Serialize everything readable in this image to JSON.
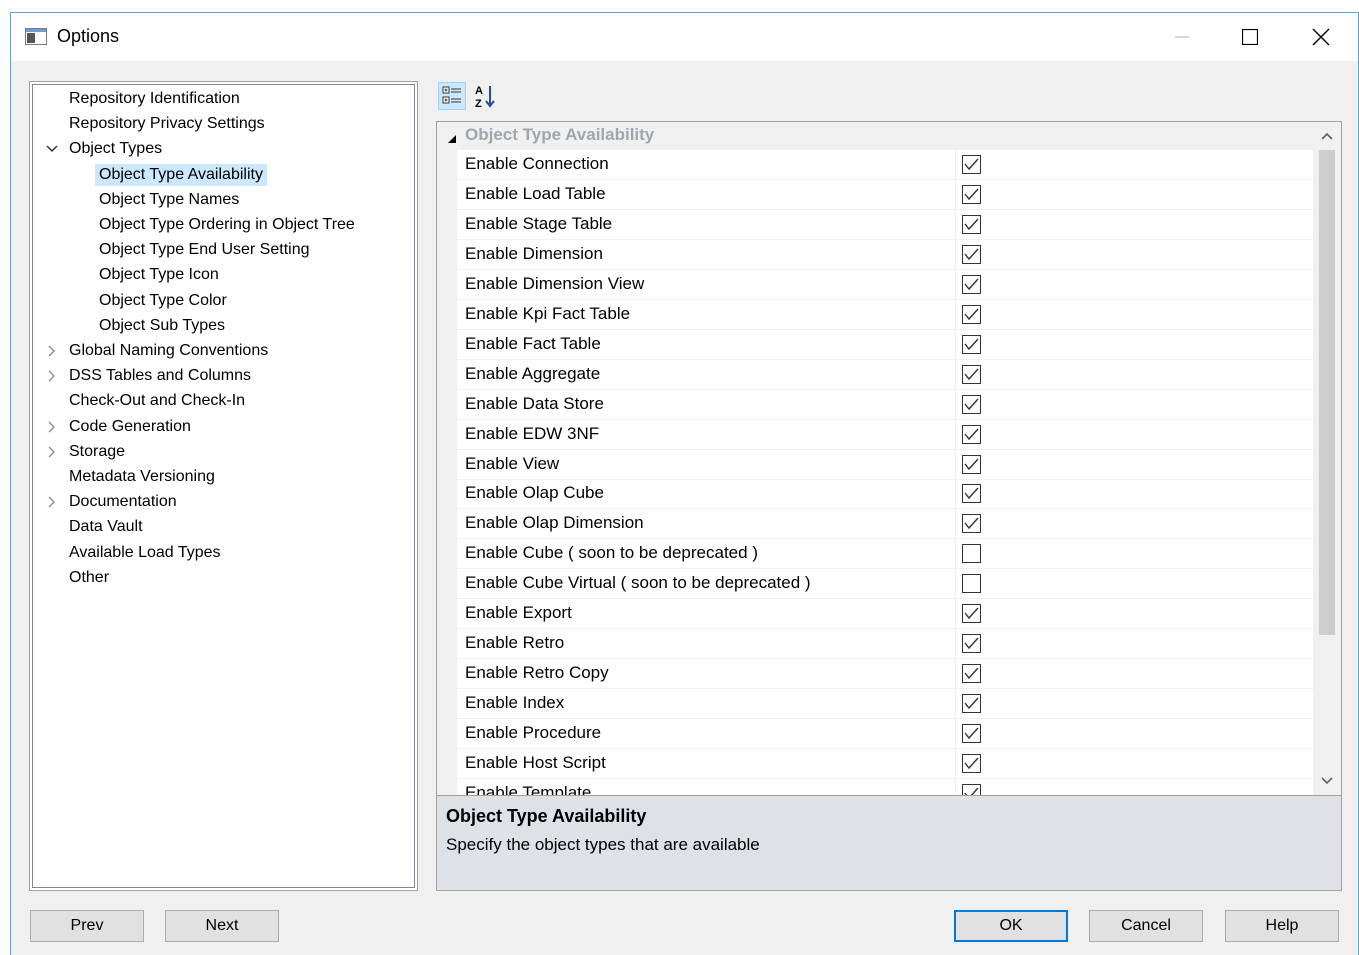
{
  "window": {
    "title": "Options"
  },
  "tree": {
    "items": [
      {
        "label": "Repository Identification",
        "level": 0,
        "expander": "none",
        "selected": false
      },
      {
        "label": "Repository Privacy Settings",
        "level": 0,
        "expander": "none",
        "selected": false
      },
      {
        "label": "Object Types",
        "level": 0,
        "expander": "expanded",
        "selected": false
      },
      {
        "label": "Object Type Availability",
        "level": 1,
        "expander": "none",
        "selected": true
      },
      {
        "label": "Object Type Names",
        "level": 1,
        "expander": "none",
        "selected": false
      },
      {
        "label": "Object Type Ordering in Object Tree",
        "level": 1,
        "expander": "none",
        "selected": false
      },
      {
        "label": "Object Type End User Setting",
        "level": 1,
        "expander": "none",
        "selected": false
      },
      {
        "label": "Object Type Icon",
        "level": 1,
        "expander": "none",
        "selected": false
      },
      {
        "label": "Object Type Color",
        "level": 1,
        "expander": "none",
        "selected": false
      },
      {
        "label": "Object Sub Types",
        "level": 1,
        "expander": "none",
        "selected": false
      },
      {
        "label": "Global Naming Conventions",
        "level": 0,
        "expander": "collapsed",
        "selected": false
      },
      {
        "label": "DSS Tables and Columns",
        "level": 0,
        "expander": "collapsed",
        "selected": false
      },
      {
        "label": "Check-Out and Check-In",
        "level": 0,
        "expander": "none",
        "selected": false
      },
      {
        "label": "Code Generation",
        "level": 0,
        "expander": "collapsed",
        "selected": false
      },
      {
        "label": "Storage",
        "level": 0,
        "expander": "collapsed",
        "selected": false
      },
      {
        "label": "Metadata Versioning",
        "level": 0,
        "expander": "none",
        "selected": false
      },
      {
        "label": "Documentation",
        "level": 0,
        "expander": "collapsed",
        "selected": false
      },
      {
        "label": "Data Vault",
        "level": 0,
        "expander": "none",
        "selected": false
      },
      {
        "label": "Available Load Types",
        "level": 0,
        "expander": "none",
        "selected": false
      },
      {
        "label": "Other",
        "level": 0,
        "expander": "none",
        "selected": false
      }
    ]
  },
  "grid": {
    "category": "Object Type Availability",
    "properties": [
      {
        "name": "Enable Connection",
        "checked": true
      },
      {
        "name": "Enable Load Table",
        "checked": true
      },
      {
        "name": "Enable Stage Table",
        "checked": true
      },
      {
        "name": "Enable Dimension",
        "checked": true
      },
      {
        "name": "Enable Dimension View",
        "checked": true
      },
      {
        "name": "Enable Kpi Fact Table",
        "checked": true
      },
      {
        "name": "Enable Fact Table",
        "checked": true
      },
      {
        "name": "Enable Aggregate",
        "checked": true
      },
      {
        "name": "Enable Data Store",
        "checked": true
      },
      {
        "name": "Enable EDW 3NF",
        "checked": true
      },
      {
        "name": "Enable View",
        "checked": true
      },
      {
        "name": "Enable Olap Cube",
        "checked": true
      },
      {
        "name": "Enable Olap Dimension",
        "checked": true
      },
      {
        "name": "Enable Cube  ( soon to be deprecated )",
        "checked": false
      },
      {
        "name": "Enable Cube Virtual  ( soon to be deprecated )",
        "checked": false
      },
      {
        "name": "Enable Export",
        "checked": true
      },
      {
        "name": "Enable Retro",
        "checked": true
      },
      {
        "name": "Enable Retro Copy",
        "checked": true
      },
      {
        "name": "Enable Index",
        "checked": true
      },
      {
        "name": "Enable Procedure",
        "checked": true
      },
      {
        "name": "Enable Host Script",
        "checked": true
      },
      {
        "name": "Enable Template",
        "checked": true
      }
    ]
  },
  "description": {
    "title": "Object Type Availability",
    "text": "Specify the object types that are available"
  },
  "buttons": {
    "prev": "Prev",
    "next": "Next",
    "ok": "OK",
    "cancel": "Cancel",
    "help": "Help"
  },
  "colors": {
    "selection": "#cce8ff",
    "accent": "#0078d7"
  }
}
